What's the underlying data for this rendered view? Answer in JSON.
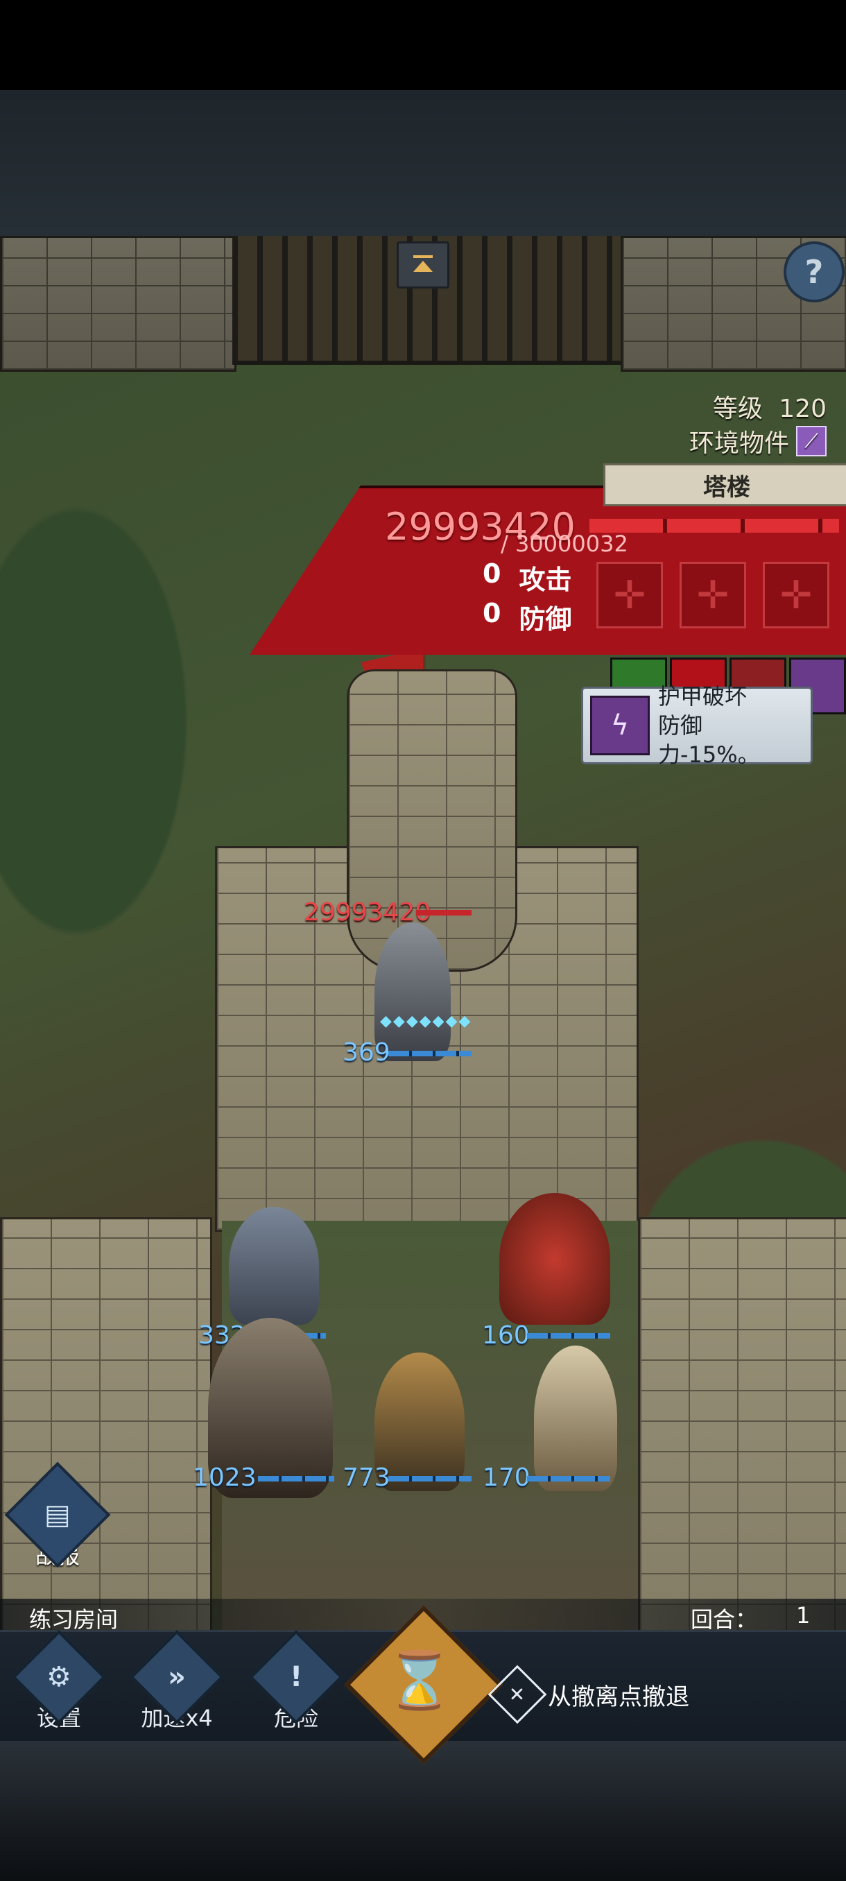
{
  "hud": {
    "level_label": "等级",
    "level_value": "120",
    "env_label": "环境物件",
    "env_icon": "wand-icon",
    "help_icon": "?"
  },
  "enemy": {
    "name_tab": "塔楼",
    "hp": "29993420",
    "hp_max": "/ 30000032",
    "attack_value": "0",
    "attack_label": "攻击",
    "defense_value": "0",
    "defense_label": "防御",
    "hp_bar_fraction": 0.9998
  },
  "tooltip": {
    "title": "护甲破坏",
    "desc": "防御力-15%。"
  },
  "field": {
    "enemy_hp_label": "29993420",
    "unit_center": "369",
    "unit_left_top": "332",
    "unit_right_top": "160",
    "unit_bottom_left": "1023",
    "unit_bottom_mid": "773",
    "unit_bottom_right": "170"
  },
  "bottom": {
    "report_label": "战报",
    "room_name": "练习房间",
    "round_label": "回合：",
    "round_value": "1",
    "settings_label": "设置",
    "speed_label": "加速x4",
    "danger_label": "危险",
    "retreat_label": "从撤离点撤退"
  },
  "colors": {
    "enemy_panel": "#a6121a",
    "ally_number": "#7cc7ff",
    "enemy_number": "#e8474a",
    "hourglass": "#c58a34"
  }
}
